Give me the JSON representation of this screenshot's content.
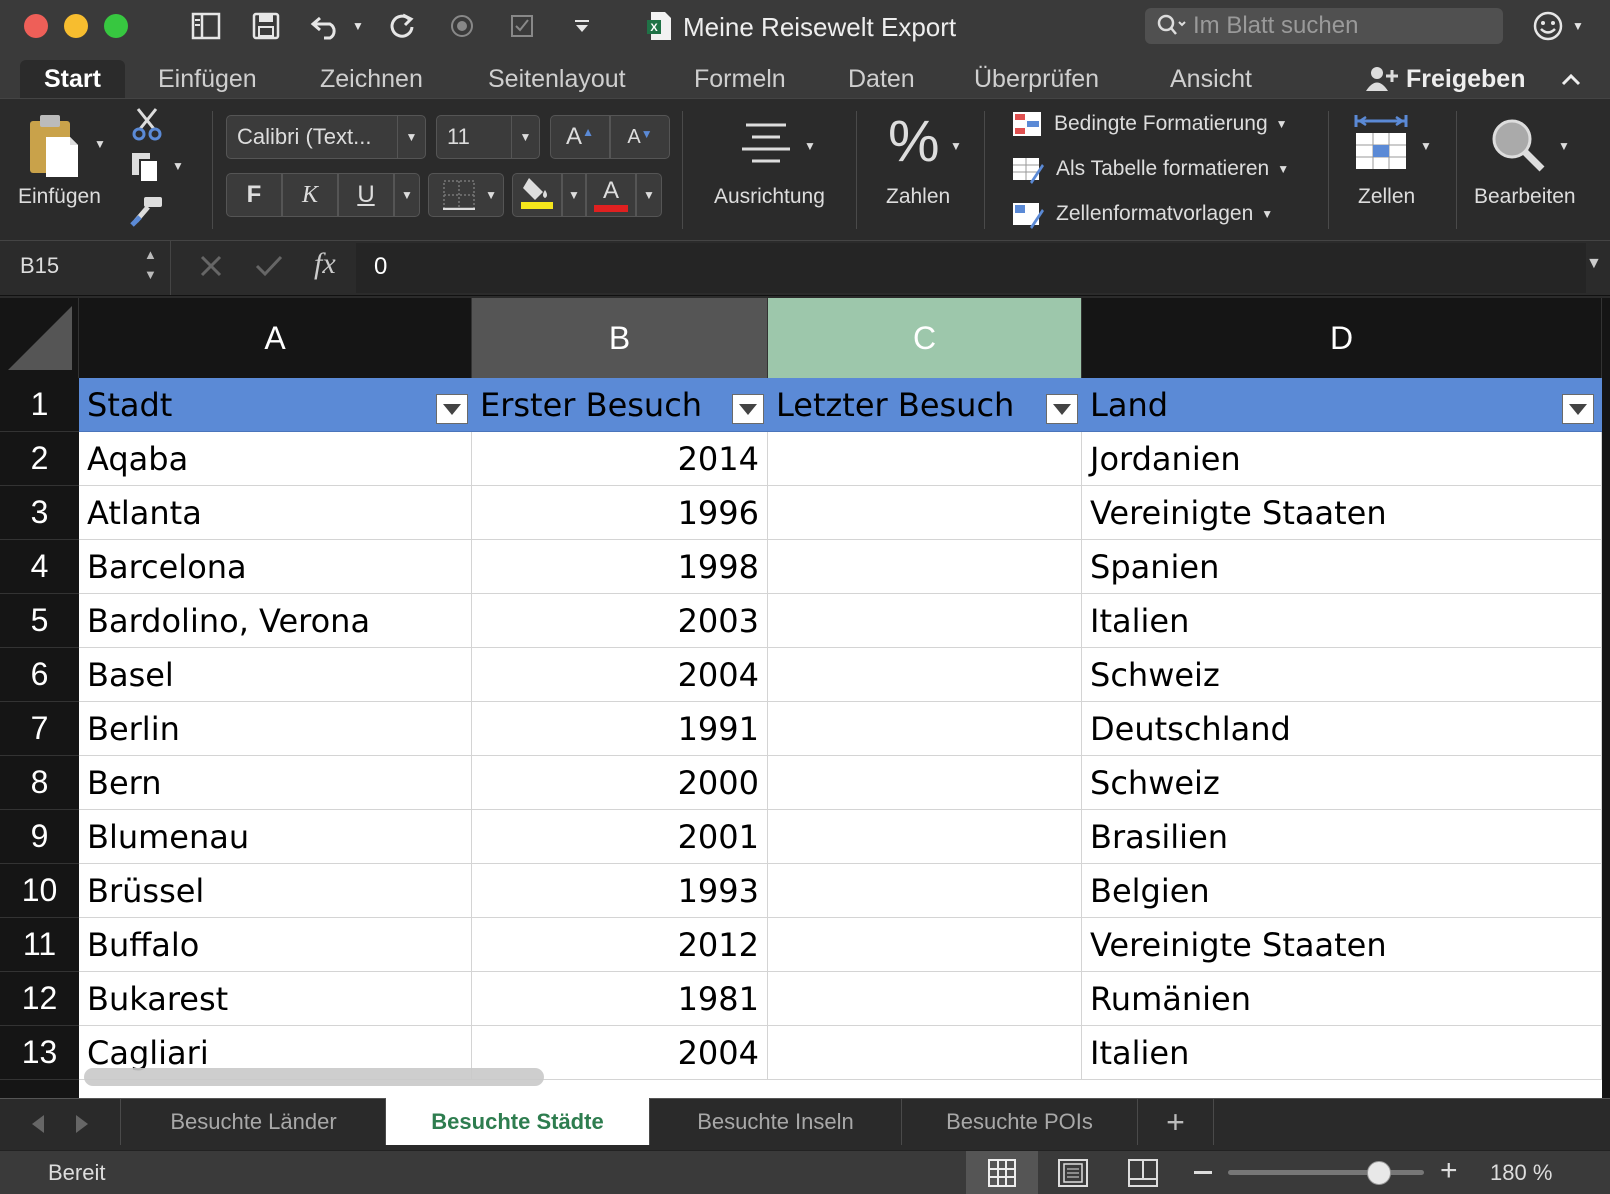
{
  "window": {
    "title": "Meine Reisewelt Export",
    "search_placeholder": "Im Blatt suchen",
    "traffic_lights": {
      "close": "#ee5f58",
      "minimize": "#f7bd2f",
      "zoom": "#37c740"
    }
  },
  "ribbon_tabs": [
    "Start",
    "Einfügen",
    "Zeichnen",
    "Seitenlayout",
    "Formeln",
    "Daten",
    "Überprüfen",
    "Ansicht"
  ],
  "share_label": "Freigeben",
  "ribbon": {
    "paste_label": "Einfügen",
    "font_name": "Calibri (Text...",
    "font_size": "11",
    "bold": "F",
    "italic": "K",
    "underline": "U",
    "grow_font": "A",
    "shrink_font": "A",
    "font_color_letter": "A",
    "highlight_color": "#f5e61c",
    "font_color": "#e02020",
    "alignment_label": "Ausrichtung",
    "number_label": "Zahlen",
    "percent_symbol": "%",
    "conditional_format": "Bedingte Formatierung",
    "format_as_table": "Als Tabelle formatieren",
    "cell_styles": "Zellenformatvorlagen",
    "cells_label": "Zellen",
    "editing_label": "Bearbeiten"
  },
  "formula_bar": {
    "cell_ref": "B15",
    "fx": "fx",
    "value": "0"
  },
  "columns": [
    "A",
    "B",
    "C",
    "D"
  ],
  "table": {
    "headers": [
      "Stadt",
      "Erster Besuch",
      "Letzter Besuch",
      "Land"
    ],
    "rows": [
      {
        "row": "2",
        "city": "Aqaba",
        "first": "2014",
        "last": "",
        "country": "Jordanien"
      },
      {
        "row": "3",
        "city": "Atlanta",
        "first": "1996",
        "last": "",
        "country": "Vereinigte Staaten"
      },
      {
        "row": "4",
        "city": "Barcelona",
        "first": "1998",
        "last": "",
        "country": "Spanien"
      },
      {
        "row": "5",
        "city": "Bardolino, Verona",
        "first": "2003",
        "last": "",
        "country": "Italien"
      },
      {
        "row": "6",
        "city": "Basel",
        "first": "2004",
        "last": "",
        "country": "Schweiz"
      },
      {
        "row": "7",
        "city": "Berlin",
        "first": "1991",
        "last": "",
        "country": "Deutschland"
      },
      {
        "row": "8",
        "city": "Bern",
        "first": "2000",
        "last": "",
        "country": "Schweiz"
      },
      {
        "row": "9",
        "city": "Blumenau",
        "first": "2001",
        "last": "",
        "country": "Brasilien"
      },
      {
        "row": "10",
        "city": "Brüssel",
        "first": "1993",
        "last": "",
        "country": "Belgien"
      },
      {
        "row": "11",
        "city": "Buffalo",
        "first": "2012",
        "last": "",
        "country": "Vereinigte Staaten"
      },
      {
        "row": "12",
        "city": "Bukarest",
        "first": "1981",
        "last": "",
        "country": "Rumänien"
      },
      {
        "row": "13",
        "city": "Cagliari",
        "first": "2004",
        "last": "",
        "country": "Italien"
      }
    ]
  },
  "header_row": "1",
  "sheets": [
    "Besuchte Länder",
    "Besuchte Städte",
    "Besuchte Inseln",
    "Besuchte POIs"
  ],
  "active_sheet": "Besuchte Städte",
  "add_sheet": "+",
  "status": {
    "text": "Bereit",
    "zoom": "180 %",
    "zoom_fraction": 0.77
  },
  "colors": {
    "table_header": "#5b8ad6",
    "selected_col_c": "#9dc7ab",
    "active_sheet_text": "#2e7d4f"
  }
}
